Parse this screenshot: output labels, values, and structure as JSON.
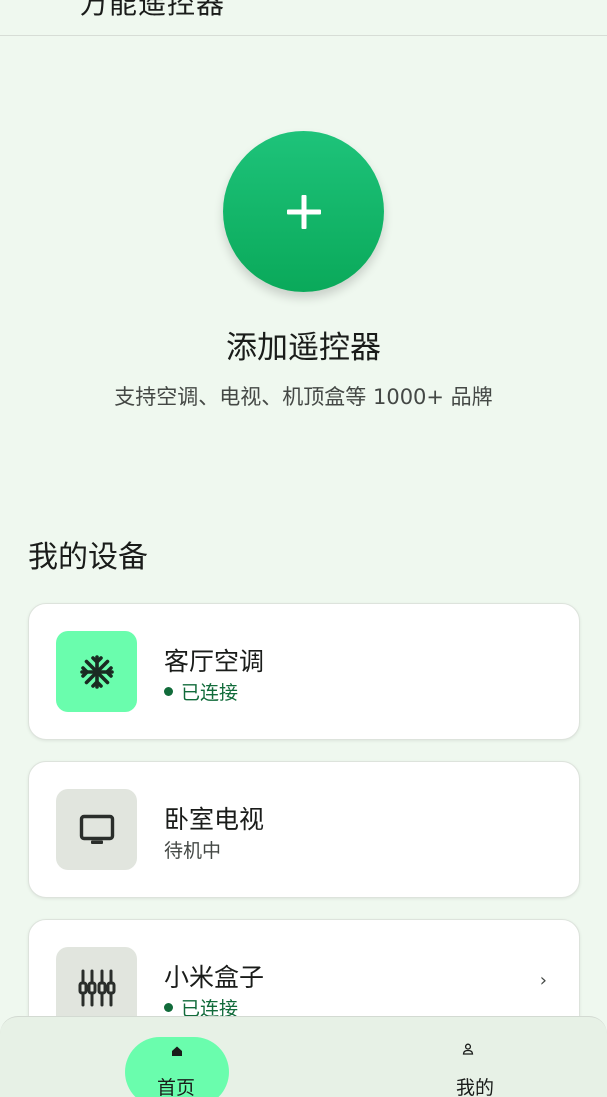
{
  "header": {
    "title": "万能遥控器"
  },
  "add": {
    "title": "添加遥控器",
    "subtitle": "支持空调、电视、机顶盒等 1000+ 品牌"
  },
  "section": {
    "title": "我的设备"
  },
  "devices": [
    {
      "name": "客厅空调",
      "status": "已连接",
      "icon": "snowflake-icon"
    },
    {
      "name": "卧室电视",
      "status": "待机中",
      "icon": "tv-icon"
    },
    {
      "name": "小米盒子",
      "status": "已连接",
      "icon": "equalizer-icon"
    }
  ],
  "nav": {
    "home": "首页",
    "mine": "我的"
  },
  "colors": {
    "accent": "#0aa95a",
    "tonal": "#6afdad",
    "connected": "#116b3a",
    "background": "#eff8ef"
  }
}
